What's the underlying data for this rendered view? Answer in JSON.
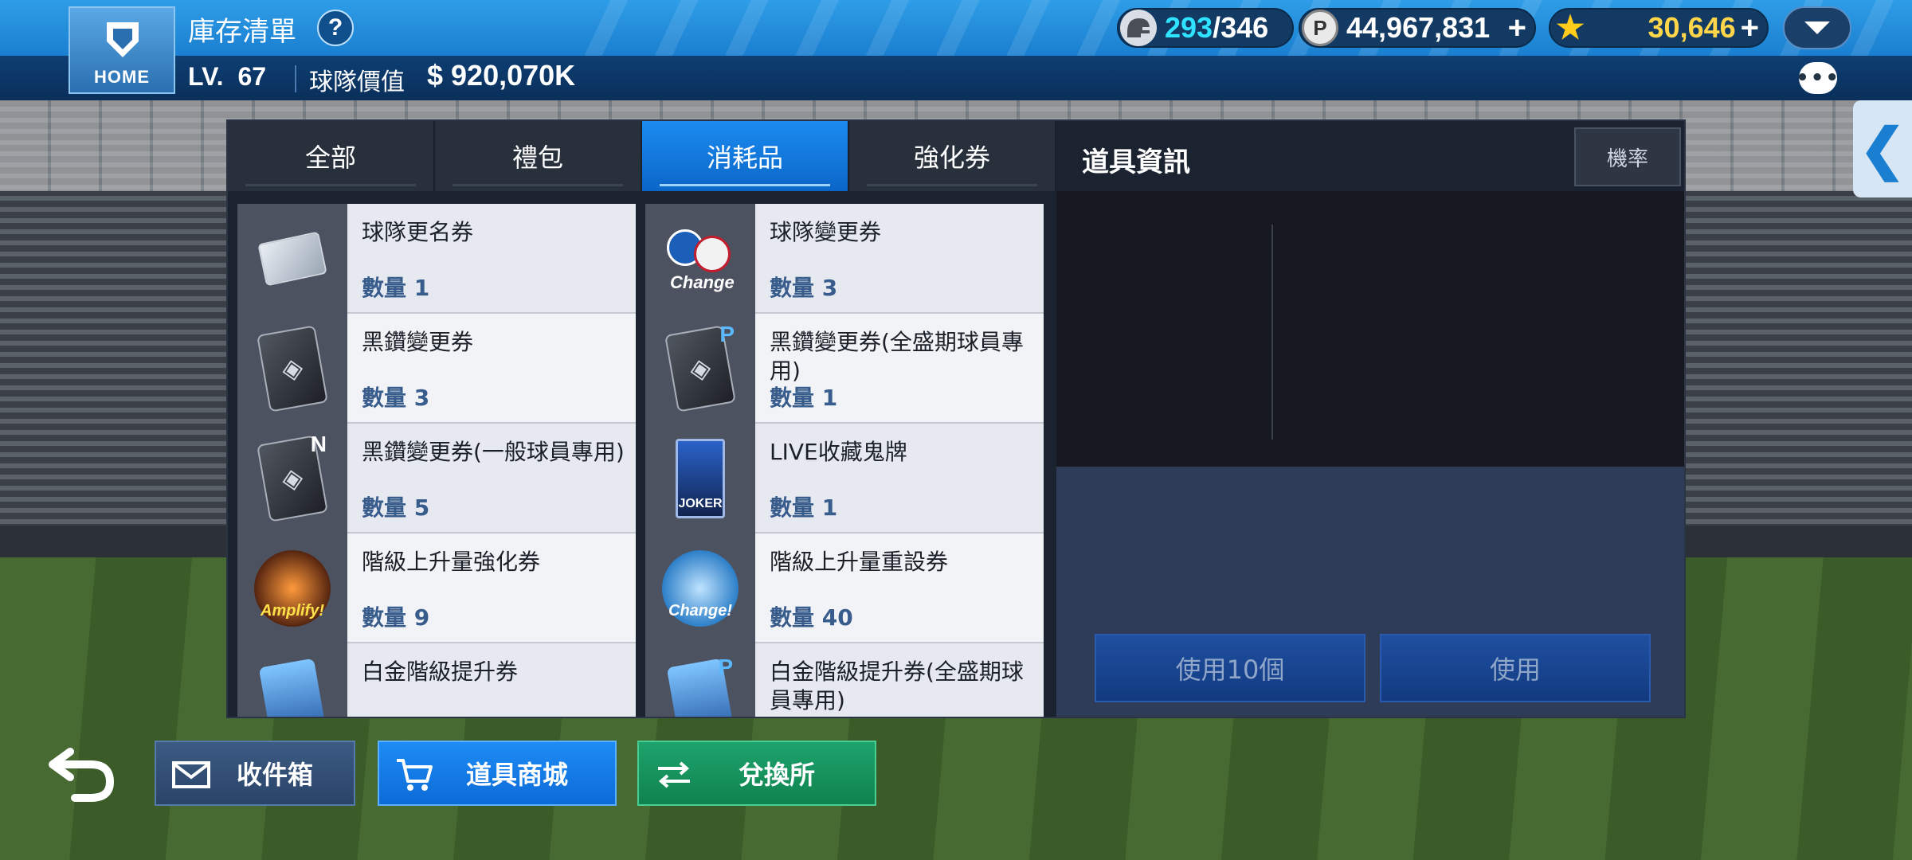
{
  "header": {
    "home_label": "HOME",
    "title": "庫存清單",
    "help_glyph": "?",
    "level_label": "LV.",
    "level": "67",
    "team_value_label": "球隊價值",
    "team_value": "$ 920,070K"
  },
  "currencies": {
    "stamina_current": "293",
    "stamina_max": "/346",
    "points_glyph": "P",
    "points": "44,967,831",
    "stars": "30,646",
    "plus": "+",
    "star_glyph": "★"
  },
  "chat_glyph": "•••",
  "side_tab_glyph": "❮",
  "tabs": [
    {
      "label": "全部",
      "active": false
    },
    {
      "label": "禮包",
      "active": false
    },
    {
      "label": "消耗品",
      "active": true
    },
    {
      "label": "強化券",
      "active": false
    }
  ],
  "items": [
    {
      "name": "球隊更名券",
      "qty": "數量 1",
      "icon": "ticket-icon"
    },
    {
      "name": "球隊變更券",
      "qty": "數量 3",
      "icon": "team-change-icon"
    },
    {
      "name": "黑鑽變更券",
      "qty": "數量 3",
      "icon": "black-diamond-icon"
    },
    {
      "name": "黑鑽變更券(全盛期球員專用)",
      "qty": "數量 1",
      "icon": "black-diamond-p-icon"
    },
    {
      "name": "黑鑽變更券(一般球員專用)",
      "qty": "數量 5",
      "icon": "black-diamond-n-icon"
    },
    {
      "name": "LIVE收藏鬼牌",
      "qty": "數量 1",
      "icon": "joker-icon"
    },
    {
      "name": "階級上升量強化券",
      "qty": "數量 9",
      "icon": "amplify-icon"
    },
    {
      "name": "階級上升量重設券",
      "qty": "數量 40",
      "icon": "change-icon"
    },
    {
      "name": "白金階級提升券",
      "qty": "",
      "icon": "platinum-icon"
    },
    {
      "name": "白金階級提升券(全盛期球員專用)",
      "qty": "",
      "icon": "platinum-p-icon"
    }
  ],
  "icon_text": {
    "change": "Change",
    "amplify": "Amplify!",
    "change_bang": "Change!",
    "joker": "JOKER",
    "tag_n": "N",
    "tag_p": "P",
    "diamond": "◈"
  },
  "info_panel": {
    "title": "道具資訊",
    "rate_button": "機率",
    "use_ten_button": "使用10個",
    "use_button": "使用"
  },
  "bottom_nav": {
    "mailbox": "收件箱",
    "shop": "道具商城",
    "exchange": "兌換所"
  },
  "colors": {
    "accent_blue": "#1b8bf0",
    "exchange_green": "#1ea36d",
    "star_yellow": "#ffd54a",
    "stamina_cyan": "#2fe2ff"
  }
}
